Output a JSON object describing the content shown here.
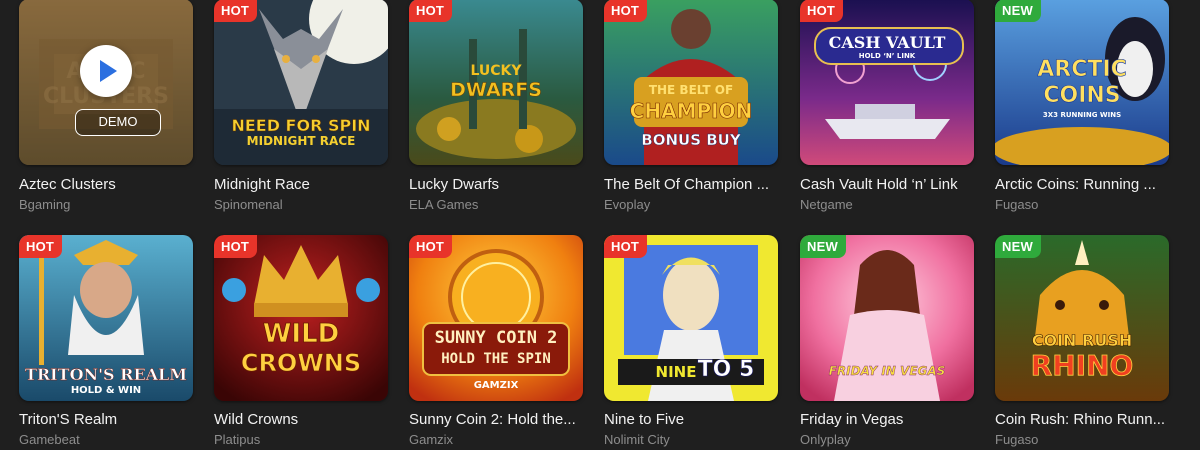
{
  "cards": [
    {
      "title": "Aztec Clusters",
      "provider": "Bgaming",
      "badge": "",
      "demo_label": "DEMO",
      "logo": "AZTEC CLUSTERS",
      "colors": [
        "#c98a3a",
        "#7a5a2a"
      ]
    },
    {
      "title": "Midnight Race",
      "provider": "Spinomenal",
      "badge": "HOT",
      "logo_line1": "NEED FOR SPIN",
      "logo_line2": "MIDNIGHT RACE",
      "colors": [
        "#7a8aa0",
        "#2c3a4a"
      ]
    },
    {
      "title": "Lucky Dwarfs",
      "provider": "ELA Games",
      "badge": "HOT",
      "logo_line1": "LUCKY",
      "logo_line2": "DWARFS",
      "colors": [
        "#2f6f7a",
        "#5a6a2a"
      ]
    },
    {
      "title": "The Belt Of Champion ...",
      "provider": "Evoplay",
      "badge": "HOT",
      "logo_line1": "THE BELT OF",
      "logo_line2": "CHAMPION",
      "logo_line3": "BONUS BUY",
      "colors": [
        "#2a8a4a",
        "#1a3f8a"
      ]
    },
    {
      "title": "Cash Vault Hold ‘n’ Link",
      "provider": "Netgame",
      "badge": "HOT",
      "logo_line1": "CASH VAULT",
      "logo_line2": "HOLD ‘N’ LINK",
      "colors": [
        "#2a1a6a",
        "#b0306a"
      ]
    },
    {
      "title": "Arctic Coins: Running ...",
      "provider": "Fugaso",
      "badge": "NEW",
      "logo_line1": "ARCTIC",
      "logo_line2": "COINS",
      "logo_line3": "3X3 RUNNING WINS",
      "colors": [
        "#3a7ad0",
        "#1a3a8a"
      ]
    },
    {
      "title": "Triton'S Realm",
      "provider": "Gamebeat",
      "badge": "HOT",
      "logo_line1": "TRITON'S REALM",
      "logo_line2": "HOLD & WIN",
      "colors": [
        "#3a8ab0",
        "#1a3a5a"
      ]
    },
    {
      "title": "Wild Crowns",
      "provider": "Platipus",
      "badge": "HOT",
      "logo_line1": "WILD",
      "logo_line2": "CROWNS",
      "colors": [
        "#8a1010",
        "#3a0505"
      ]
    },
    {
      "title": "Sunny Coin 2: Hold the...",
      "provider": "Gamzix",
      "badge": "HOT",
      "logo_line1": "SUNNY COIN 2",
      "logo_line2": "HOLD THE SPIN",
      "logo_line3": "GAMZIX",
      "colors": [
        "#f0a020",
        "#d04010"
      ]
    },
    {
      "title": "Nine to Five",
      "provider": "Nolimit City",
      "badge": "HOT",
      "logo_line1": "NINE",
      "logo_line2": "TO 5",
      "colors": [
        "#e8e030",
        "#3a6ad0"
      ]
    },
    {
      "title": "Friday in Vegas",
      "provider": "Onlyplay",
      "badge": "NEW",
      "logo_line1": "FRIDAY IN VEGAS",
      "colors": [
        "#f06090",
        "#f8b0c0"
      ]
    },
    {
      "title": "Coin Rush: Rhino Runn...",
      "provider": "Fugaso",
      "badge": "NEW",
      "logo_line1": "COIN RUSH",
      "logo_line2": "RHINO",
      "colors": [
        "#2a7a2a",
        "#d07a10"
      ]
    }
  ]
}
